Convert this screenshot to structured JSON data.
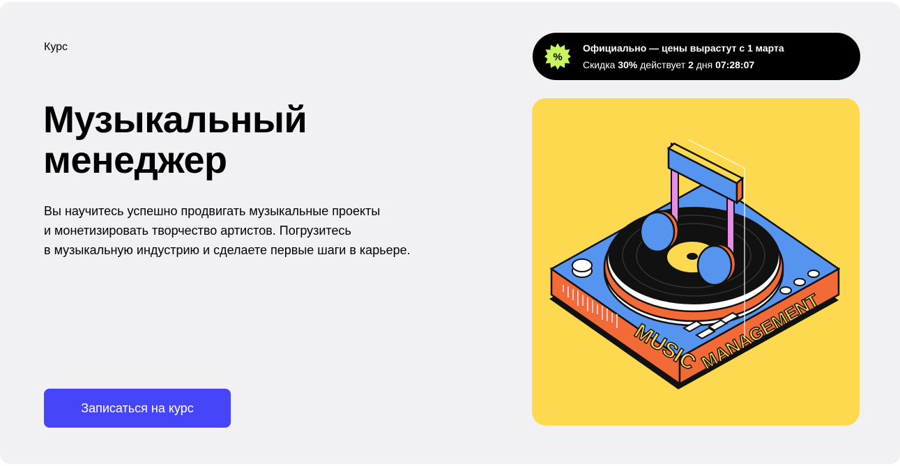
{
  "course": {
    "kind_label": "Курс",
    "title_lines": [
      "Музыкальный",
      "менеджер"
    ],
    "description_lines": [
      "Вы научитесь успешно продвигать музыкальные проекты",
      "и монетизировать творчество артистов. Погрузитесь",
      "в музыкальную индустрию и сделаете первые шаги в карьере."
    ],
    "cta_label": "Записаться на курс"
  },
  "promo": {
    "icon": "percent-badge-icon",
    "headline": "Официально — цены вырастут с 1 марта",
    "discount_prefix": "Скидка",
    "discount_value": "30%",
    "discount_middle": "действует",
    "days_value": "2",
    "days_unit": "дня",
    "timer": "07:28:07"
  },
  "illustration": {
    "icon": "turntable-music-note-illustration",
    "text": "MUSIC MANAGEMENT"
  },
  "colors": {
    "page_bg": "#f1f1f4",
    "cta_bg": "#4645fa",
    "promo_bg": "#000000",
    "promo_icon": "#c8f560",
    "art_bg": "#fdd94f",
    "accent_blue": "#5595f0",
    "accent_orange": "#f26a35",
    "accent_pink": "#e88ce8"
  }
}
